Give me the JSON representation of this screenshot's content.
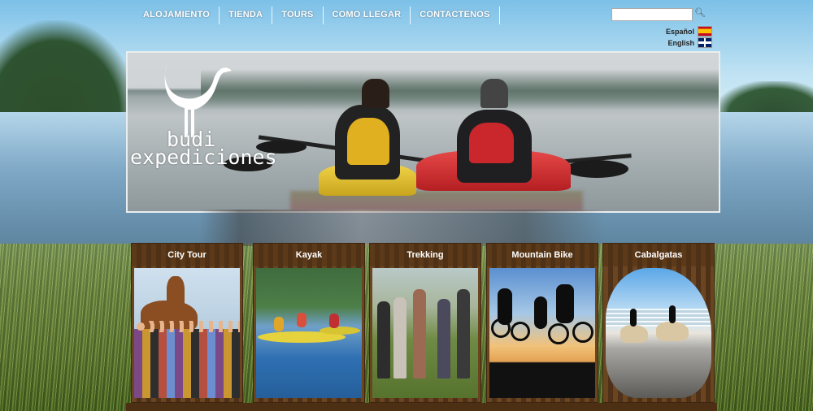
{
  "nav": {
    "items": [
      "ALOJAMIENTO",
      "TIENDA",
      "TOURS",
      "COMO LLEGAR",
      "CONTACTENOS"
    ]
  },
  "search": {
    "placeholder": "",
    "value": ""
  },
  "languages": [
    {
      "label": "Español",
      "flag": "spain-flag-icon"
    },
    {
      "label": "English",
      "flag": "uk-flag-icon"
    }
  ],
  "brand": {
    "line1": "budi",
    "line2": "expediciones"
  },
  "activities": [
    {
      "title": "City Tour"
    },
    {
      "title": "Kayak"
    },
    {
      "title": "Trekking"
    },
    {
      "title": "Mountain Bike"
    },
    {
      "title": "Cabalgatas"
    }
  ],
  "colors": {
    "card_wood": "#5b3a1d",
    "nav_text": "#ffffff"
  }
}
